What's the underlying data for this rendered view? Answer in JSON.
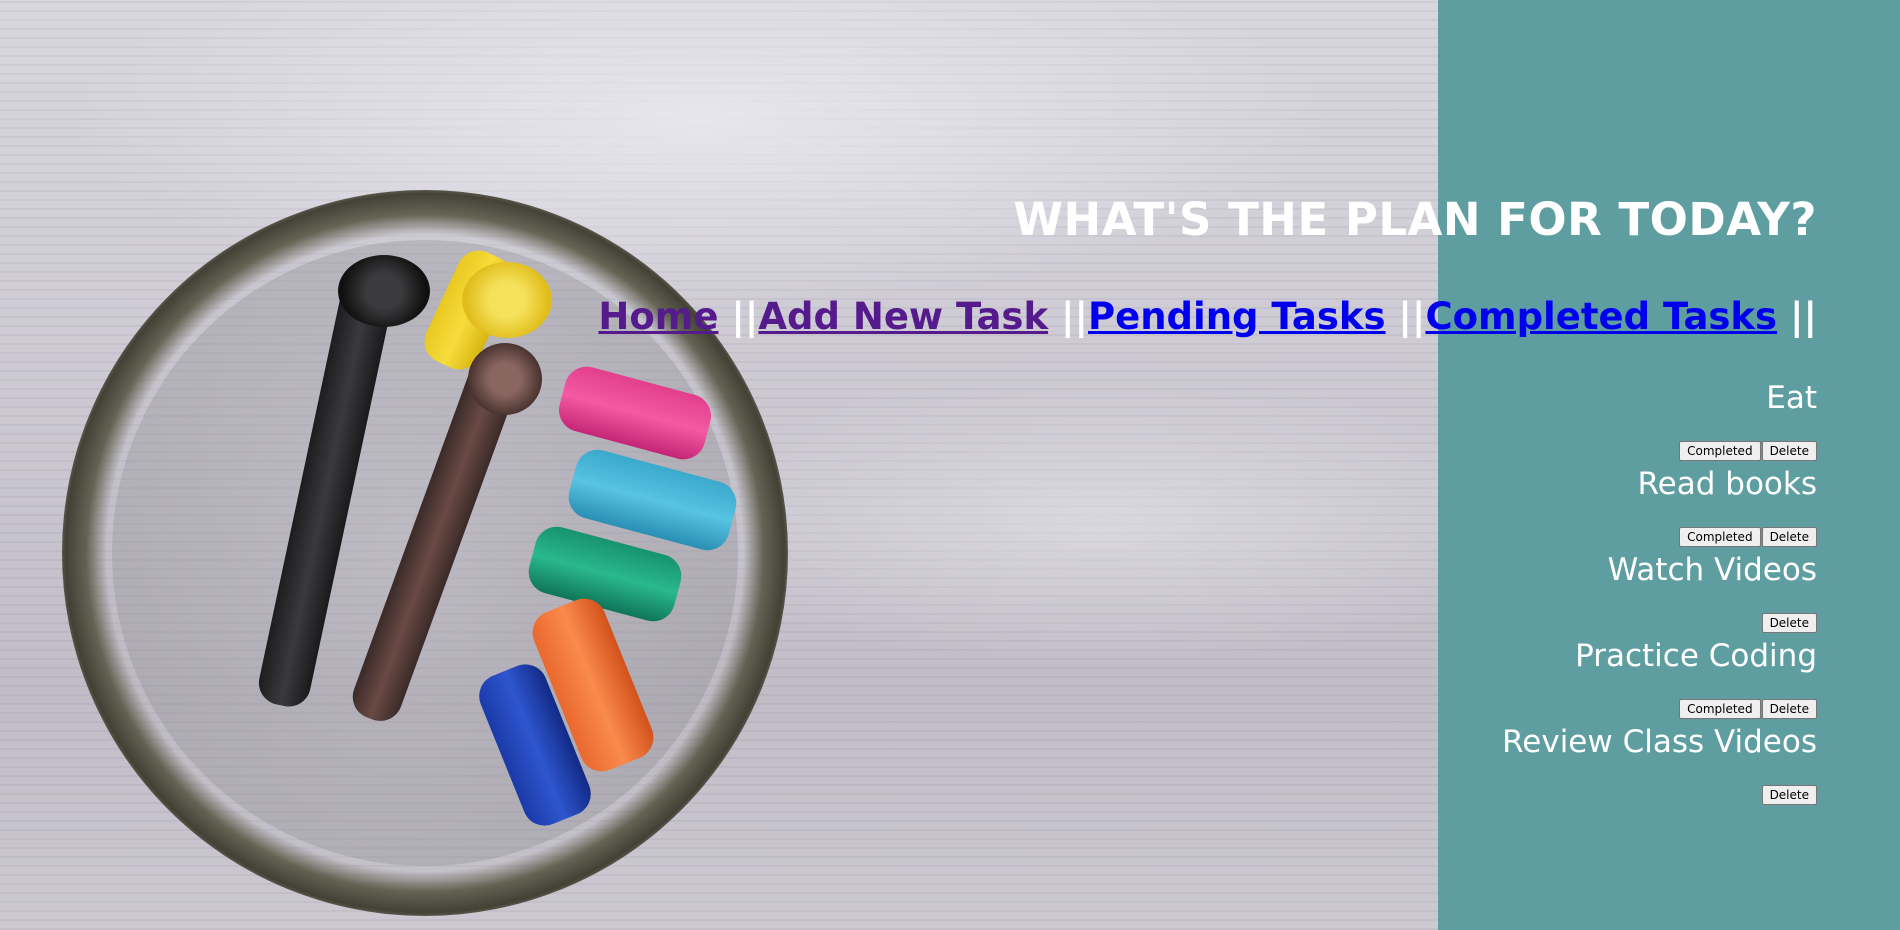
{
  "header": {
    "title": "WHAT'S THE PLAN FOR TODAY?"
  },
  "nav": {
    "items": [
      {
        "label": "Home",
        "visited": true
      },
      {
        "label": "Add New Task",
        "visited": true
      },
      {
        "label": "Pending Tasks",
        "visited": false
      },
      {
        "label": "Completed Tasks",
        "visited": false
      }
    ],
    "separator": "||"
  },
  "tasks": [
    {
      "name": "Eat",
      "completed_label": "Completed",
      "delete_label": "Delete",
      "show_completed": true
    },
    {
      "name": "Read books",
      "completed_label": "Completed",
      "delete_label": "Delete",
      "show_completed": true
    },
    {
      "name": "Watch Videos",
      "completed_label": "",
      "delete_label": "Delete",
      "show_completed": false
    },
    {
      "name": "Practice Coding",
      "completed_label": "Completed",
      "delete_label": "Delete",
      "show_completed": true
    },
    {
      "name": "Review Class Videos",
      "completed_label": "",
      "delete_label": "Delete",
      "show_completed": false
    }
  ],
  "colors": {
    "panel": "#5f9ea0",
    "link": "#0000ee",
    "visited_link": "#551a8b",
    "text": "#ffffff"
  }
}
